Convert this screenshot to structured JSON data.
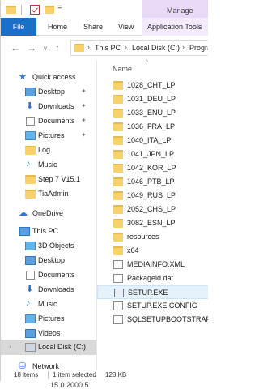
{
  "titlebar": {
    "manage_label": "Manage",
    "qa_sep": "="
  },
  "ribbon": {
    "tabs": [
      "File",
      "Home",
      "Share",
      "View"
    ],
    "app_tools_label": "Application Tools"
  },
  "address": {
    "back": "←",
    "forward": "→",
    "recent": "∨",
    "up": "↑",
    "crumbs": [
      "This PC",
      "Local Disk (C:)",
      "Progra"
    ]
  },
  "nav_pane": {
    "items": [
      {
        "label": "Quick access",
        "pinned": false
      },
      {
        "label": "Desktop",
        "pinned": true
      },
      {
        "label": "Downloads",
        "pinned": true
      },
      {
        "label": "Documents",
        "pinned": true
      },
      {
        "label": "Pictures",
        "pinned": true
      },
      {
        "label": "Log",
        "pinned": false
      },
      {
        "label": "Music",
        "pinned": false
      },
      {
        "label": "Step 7 V15.1",
        "pinned": false
      },
      {
        "label": "TiaAdmin",
        "pinned": false
      },
      {
        "label": "OneDrive",
        "pinned": false
      },
      {
        "label": "This PC",
        "pinned": false
      },
      {
        "label": "3D Objects",
        "pinned": false
      },
      {
        "label": "Desktop",
        "pinned": false
      },
      {
        "label": "Documents",
        "pinned": false
      },
      {
        "label": "Downloads",
        "pinned": false
      },
      {
        "label": "Music",
        "pinned": false
      },
      {
        "label": "Pictures",
        "pinned": false
      },
      {
        "label": "Videos",
        "pinned": false
      },
      {
        "label": "Local Disk (C:)",
        "pinned": false
      },
      {
        "label": "Network",
        "pinned": false
      }
    ],
    "pin_glyph": "📌",
    "expand_glyph": "›"
  },
  "file_list": {
    "column_header": "Name",
    "sort_caret": "^",
    "items": [
      "1028_CHT_LP",
      "1031_DEU_LP",
      "1033_ENU_LP",
      "1036_FRA_LP",
      "1040_ITA_LP",
      "1041_JPN_LP",
      "1042_KOR_LP",
      "1046_PTB_LP",
      "1049_RUS_LP",
      "2052_CHS_LP",
      "3082_ESN_LP",
      "resources",
      "x64",
      "MEDIAINFO.XML",
      "Packageld.dat",
      "SETUP.EXE",
      "SETUP.EXE.CONFIG",
      "SQLSETUPBOOTSTRAPPER."
    ],
    "selected": "SETUP.EXE"
  },
  "status_bar": {
    "count": "18 items",
    "selection": "1 item selected",
    "size": "128 KB"
  },
  "background_text": "15.0.2000.5"
}
